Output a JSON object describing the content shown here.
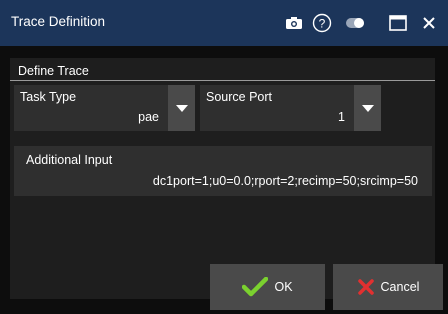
{
  "window": {
    "title": "Trace Definition"
  },
  "titlebar_icons": [
    "camera-icon",
    "help-icon",
    "toggle-icon",
    "maximize-icon",
    "close-icon"
  ],
  "section": {
    "label": "Define Trace"
  },
  "task_type": {
    "label": "Task Type",
    "value": "pae"
  },
  "source_port": {
    "label": "Source Port",
    "value": "1"
  },
  "additional_input": {
    "label": "Additional Input",
    "value": "dc1port=1;u0=0.0;rport=2;recimp=50;srcimp=50"
  },
  "buttons": {
    "ok": "OK",
    "cancel": "Cancel"
  },
  "colors": {
    "title_bar": "#1c355a",
    "panel": "#1e1e1e",
    "field": "#2f2f2f",
    "button": "#4a4a4a",
    "ok_check": "#7bd12f",
    "cancel_x": "#e23030"
  }
}
